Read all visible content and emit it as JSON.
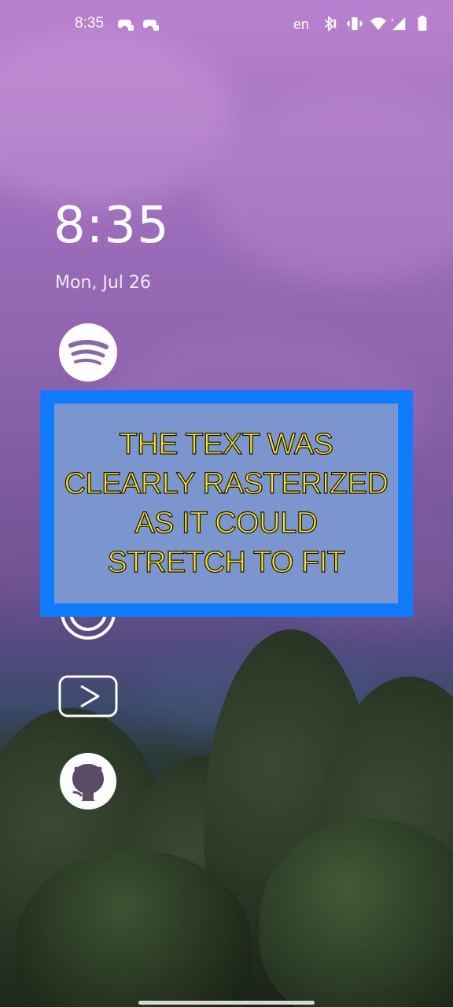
{
  "status_bar": {
    "time": "8:35",
    "language": "en",
    "icons": [
      "game-controller-icon",
      "game-controller-icon",
      "bluetooth-icon",
      "vibrate-icon",
      "wifi-icon",
      "signal-icon",
      "battery-icon"
    ]
  },
  "lockscreen": {
    "time": "8:35",
    "date": "Mon, Jul 26",
    "shortcuts": [
      "spotify-icon",
      "podcast-icon",
      "youtube-icon",
      "github-icon"
    ]
  },
  "overlay": {
    "lines": [
      "THE TEXT WAS",
      "CLEARLY RASTERIZED",
      "AS IT COULD",
      "STRETCH TO FIT"
    ],
    "text_color": "#ffe600",
    "border_color": "#0f7bff",
    "fill_color": "#7b95cf"
  }
}
